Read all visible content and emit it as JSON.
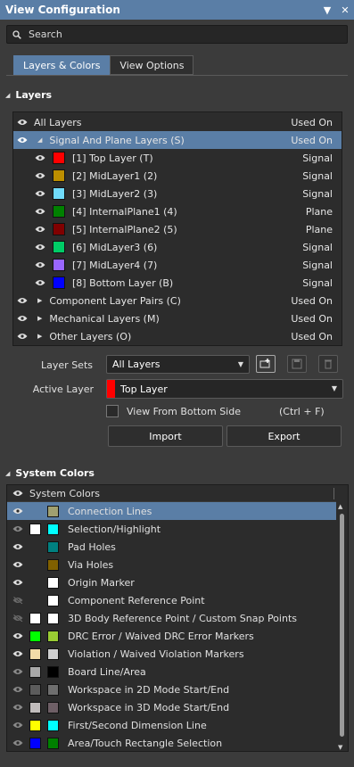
{
  "window": {
    "title": "View Configuration"
  },
  "search": {
    "placeholder": "Search"
  },
  "tabs": [
    {
      "label": "Layers & Colors"
    },
    {
      "label": "View Options"
    }
  ],
  "layers_section": {
    "title": "Layers",
    "all_layers": {
      "label": "All Layers",
      "status": "Used On"
    },
    "signal_plane": {
      "label": "Signal And Plane Layers (S)",
      "status": "Used On"
    },
    "layer_rows": [
      {
        "label": "[1] Top Layer (T)",
        "type": "Signal",
        "color": "#ff0000"
      },
      {
        "label": "[2] MidLayer1 (2)",
        "type": "Signal",
        "color": "#bc8e00"
      },
      {
        "label": "[3] MidLayer2 (3)",
        "type": "Signal",
        "color": "#70dbfa"
      },
      {
        "label": "[4] InternalPlane1 (4)",
        "type": "Plane",
        "color": "#008000"
      },
      {
        "label": "[5] InternalPlane2 (5)",
        "type": "Plane",
        "color": "#800000"
      },
      {
        "label": "[6] MidLayer3 (6)",
        "type": "Signal",
        "color": "#00cc66"
      },
      {
        "label": "[7] MidLayer4 (7)",
        "type": "Signal",
        "color": "#9966ff"
      },
      {
        "label": "[8] Bottom Layer (B)",
        "type": "Signal",
        "color": "#0000ff"
      }
    ],
    "groups": [
      {
        "label": "Component Layer Pairs (C)",
        "status": "Used On"
      },
      {
        "label": "Mechanical Layers (M)",
        "status": "Used On"
      },
      {
        "label": "Other Layers (O)",
        "status": "Used On"
      }
    ]
  },
  "form": {
    "layer_sets_label": "Layer Sets",
    "layer_sets_value": "All Layers",
    "active_layer_label": "Active Layer",
    "active_layer_value": "Top Layer",
    "active_layer_color": "#ff0000",
    "view_bottom_label": "View From Bottom Side",
    "view_bottom_shortcut": "(Ctrl + F)",
    "import_label": "Import",
    "export_label": "Export"
  },
  "system_section": {
    "title": "System Colors",
    "header": "System Colors",
    "rows": [
      {
        "label": "Connection Lines",
        "eye": "on",
        "c1": null,
        "c2": "#a0a070"
      },
      {
        "label": "Selection/Highlight",
        "eye": "dim",
        "c1": "#ffffff",
        "c2": "#00ffff"
      },
      {
        "label": "Pad Holes",
        "eye": "on",
        "c1": null,
        "c2": "#008080"
      },
      {
        "label": "Via Holes",
        "eye": "on",
        "c1": null,
        "c2": "#806000"
      },
      {
        "label": "Origin Marker",
        "eye": "on",
        "c1": null,
        "c2": "#ffffff"
      },
      {
        "label": "Component Reference Point",
        "eye": "off",
        "c1": null,
        "c2": "#ffffff"
      },
      {
        "label": "3D Body Reference Point / Custom Snap Points",
        "eye": "off",
        "c1": "#ffffff",
        "c2": "#ffffff"
      },
      {
        "label": "DRC Error / Waived DRC Error Markers",
        "eye": "on",
        "c1": "#00ff00",
        "c2": "#99cc33"
      },
      {
        "label": "Violation / Waived Violation Markers",
        "eye": "on",
        "c1": "#f2dca8",
        "c2": "#cfcfcf"
      },
      {
        "label": "Board Line/Area",
        "eye": "dim",
        "c1": "#a8a8a8",
        "c2": "#000000"
      },
      {
        "label": "Workspace in 2D Mode Start/End",
        "eye": "dim",
        "c1": "#5c5c5c",
        "c2": "#6e6e6e"
      },
      {
        "label": "Workspace in 3D Mode Start/End",
        "eye": "dim",
        "c1": "#c0bcbc",
        "c2": "#6e5f66"
      },
      {
        "label": "First/Second Dimension Line",
        "eye": "dim",
        "c1": "#ffff00",
        "c2": "#00ffff"
      },
      {
        "label": "Area/Touch Rectangle Selection",
        "eye": "dim",
        "c1": "#0000ff",
        "c2": "#008000"
      }
    ]
  }
}
